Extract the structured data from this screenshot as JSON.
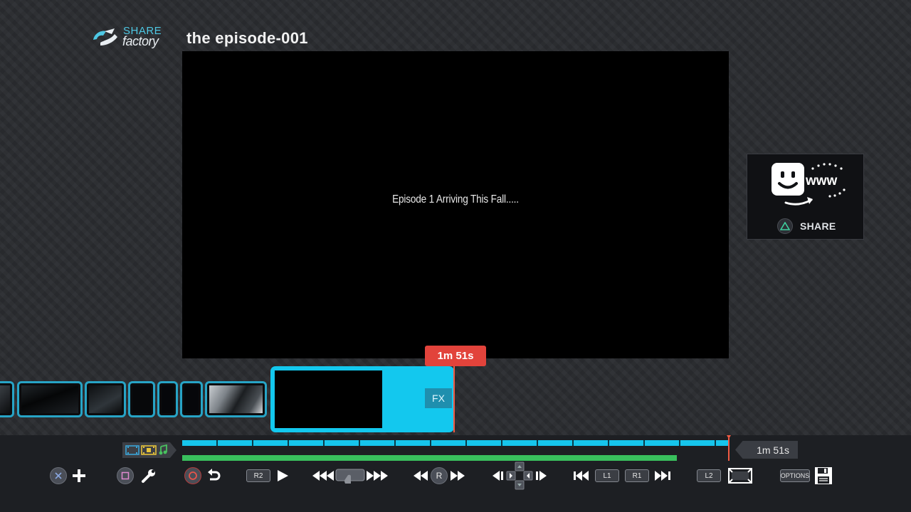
{
  "app": {
    "logo_top": "SHARE",
    "logo_bottom": "factory"
  },
  "project": {
    "title": "the episode-001"
  },
  "preview": {
    "caption": "Episode 1 Arriving This Fall....."
  },
  "share_panel": {
    "label": "SHARE",
    "icon": "smiley-www-share-icon"
  },
  "timeline": {
    "current_time": "1m 51s",
    "total_duration": "1m 51s",
    "fx_label": "FX",
    "video_progress": 1.0,
    "audio_progress": 0.905
  },
  "controls": {
    "r2": "R2",
    "l1": "L1",
    "r1": "R1",
    "l2": "L2",
    "r": "R",
    "options": "OPTIONS"
  },
  "colors": {
    "accent_cyan": "#13c8ee",
    "playhead_red": "#e2433b",
    "audio_green": "#39c05d",
    "panel_dark": "#1d1f23"
  }
}
